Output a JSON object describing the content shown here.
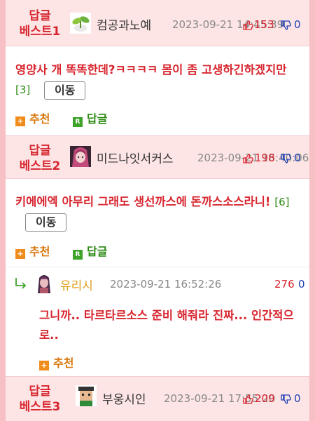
{
  "posts": [
    {
      "best_label_1": "답글",
      "best_label_2": "베스트1",
      "avatar": "sprout-avatar",
      "nickname": "컴공과노예",
      "datetime": "2023-09-21 14:45:39",
      "up_count": "153",
      "down_count": "0",
      "content": "영양사 개 똑똑한데?ㅋㅋㅋㅋ 몸이 좀 고생하긴하겠지만",
      "reply_count": "[3]",
      "move_label": "이동",
      "recommend_label": "추천",
      "reply_label": "답글"
    },
    {
      "best_label_1": "답글",
      "best_label_2": "베스트2",
      "avatar": "anime-girl-avatar",
      "nickname": "미드나잇서커스",
      "datetime": "2023-09-21 16:40:06",
      "up_count": "198",
      "down_count": "0",
      "content": "키에에엑 아무리 그래도 생선까스에 돈까스소스라니!",
      "reply_count": "[6]",
      "move_label": "이동",
      "recommend_label": "추천",
      "reply_label": "답글"
    },
    {
      "best_label_1": "답글",
      "best_label_2": "베스트3",
      "avatar": "pixel-man-avatar",
      "nickname": "부웅시인",
      "datetime": "2023-09-21 17:55:20",
      "up_count": "209",
      "down_count": "0"
    }
  ],
  "reply": {
    "avatar": "anime-character-avatar",
    "nickname": "유리시",
    "datetime": "2023-09-21 16:52:26",
    "up_count": "276",
    "down_count": "0",
    "content": "그니까.. 타르타르소스 준비 해줘라 진짜... 인간적으로..",
    "recommend_label": "추천"
  },
  "colors": {
    "accent": "#d8262f",
    "header_bg": "#fde5e6",
    "border": "#f7c0c4",
    "recommend": "#f08c1c",
    "reply": "#3ea32a",
    "down": "#1d3fb3"
  }
}
